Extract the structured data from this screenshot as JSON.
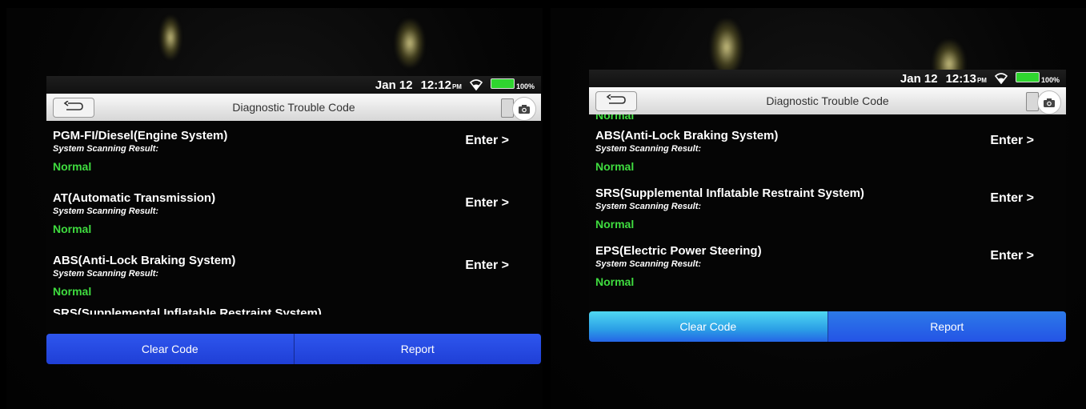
{
  "colors": {
    "normal_status": "#3fdc3f",
    "button_blue": "#2548e6",
    "battery_green": "#2fd52f"
  },
  "left_screen": {
    "status_bar": {
      "date": "Jan 12",
      "time": "12:12",
      "ampm": "PM",
      "battery": "100%"
    },
    "title": "Diagnostic Trouble Code",
    "items": [
      {
        "title": "PGM-FI/Diesel(Engine System)",
        "subtitle": "System Scanning Result:",
        "status": "Normal",
        "action": "Enter >"
      },
      {
        "title": "AT(Automatic Transmission)",
        "subtitle": "System Scanning Result:",
        "status": "Normal",
        "action": "Enter >"
      },
      {
        "title": "ABS(Anti-Lock Braking System)",
        "subtitle": "System Scanning Result:",
        "status": "Normal",
        "action": "Enter >"
      }
    ],
    "partial_item": "SRS(Supplemental Inflatable Restraint System)",
    "buttons": {
      "clear": "Clear Code",
      "report": "Report"
    }
  },
  "right_screen": {
    "status_bar": {
      "date": "Jan 12",
      "time": "12:13",
      "ampm": "PM",
      "battery": "100%"
    },
    "title": "Diagnostic Trouble Code",
    "partial_status": "Normal",
    "items": [
      {
        "title": "ABS(Anti-Lock Braking System)",
        "subtitle": "System Scanning Result:",
        "status": "Normal",
        "action": "Enter >"
      },
      {
        "title": "SRS(Supplemental Inflatable Restraint System)",
        "subtitle": "System Scanning Result:",
        "status": "Normal",
        "action": "Enter >"
      },
      {
        "title": "EPS(Electric Power Steering)",
        "subtitle": "System Scanning Result:",
        "status": "Normal",
        "action": "Enter >"
      }
    ],
    "buttons": {
      "clear": "Clear Code",
      "report": "Report"
    }
  }
}
